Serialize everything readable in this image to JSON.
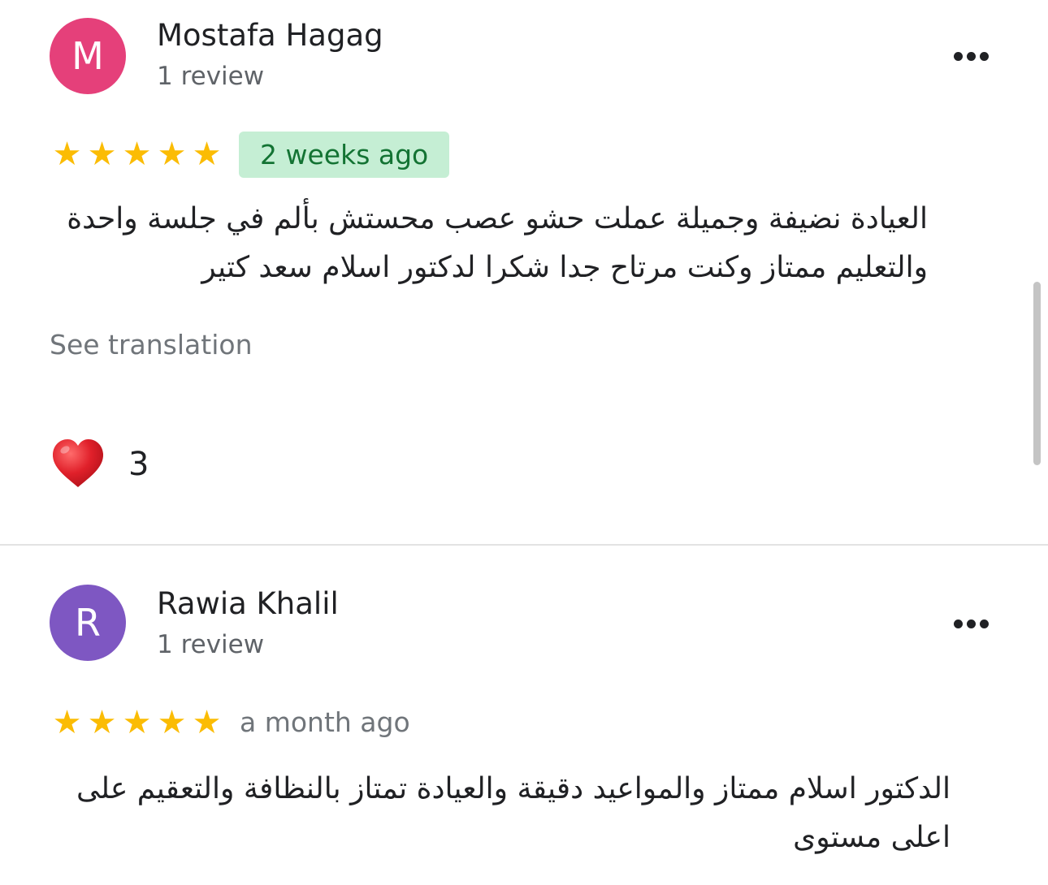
{
  "reviews": [
    {
      "avatar_letter": "M",
      "avatar_color": "#e5407a",
      "name": "Mostafa Hagag",
      "review_count": "1 review",
      "rating": 5,
      "date": "2 weeks ago",
      "date_highlighted": true,
      "text": "العيادة نضيفة وجميلة عملت حشو عصب محستش بألم في جلسة واحدة والتعليم ممتاز وكنت مرتاح جدا شكرا لدكتور اسلام سعد كتير",
      "see_translation": "See translation",
      "reaction_icon": "heart-icon",
      "reaction_count": "3"
    },
    {
      "avatar_letter": "R",
      "avatar_color": "#7e57c2",
      "name": "Rawia Khalil",
      "review_count": "1 review",
      "rating": 5,
      "date": "a month ago",
      "date_highlighted": false,
      "text": "الدكتور اسلام ممتاز  والمواعيد دقيقة والعيادة تمتاز بالنظافة والتعقيم على اعلى مستوى"
    }
  ],
  "colors": {
    "star": "#fbbc04",
    "badge_bg": "#c5eed4",
    "badge_text": "#137333",
    "secondary_text": "#5f6368",
    "heart": "#e0202a"
  }
}
